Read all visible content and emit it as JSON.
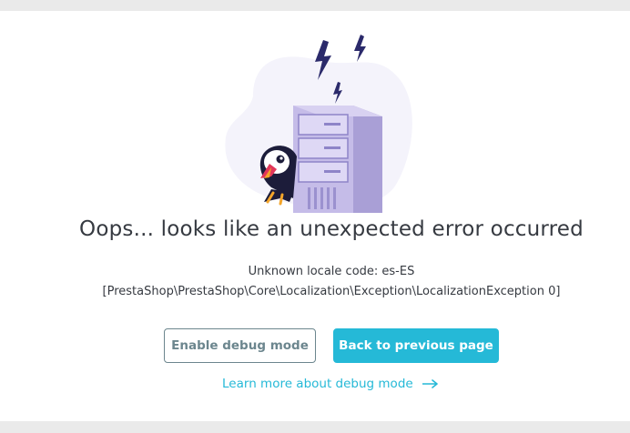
{
  "error": {
    "title": "Oops... looks like an unexpected error occurred",
    "message_line1": "Unknown locale code: es-ES",
    "message_line2": "[PrestaShop\\PrestaShop\\Core\\Localization\\Exception\\LocalizationException 0]"
  },
  "actions": {
    "debug_label": "Enable debug mode",
    "back_label": "Back to previous page",
    "learn_more_label": "Learn more about debug mode"
  },
  "icons": {
    "illustration": "server-error-illustration",
    "puffin": "puffin-mascot-icon",
    "lightning": "lightning-icon",
    "arrow": "arrow-right-icon"
  },
  "colors": {
    "primary": "#25b9d7",
    "secondary": "#6c868e",
    "text": "#363a41",
    "server": "#c5bce8",
    "blob": "#f4f3fb"
  }
}
